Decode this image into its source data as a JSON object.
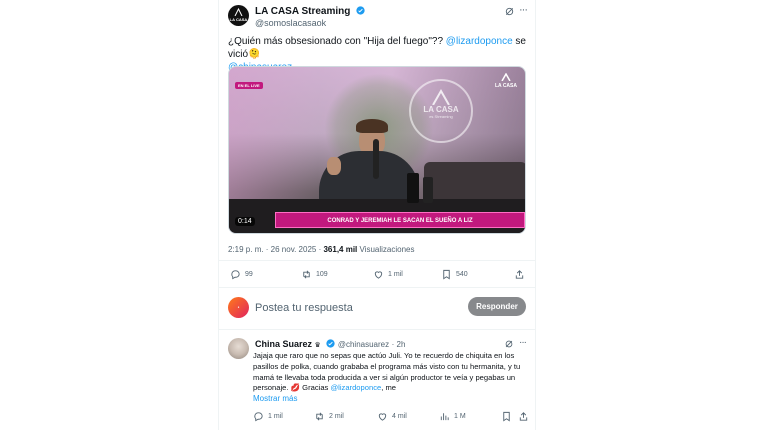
{
  "post": {
    "author_name": "LA CASA Streaming",
    "author_handle": "@somoslacasaok",
    "avatar_text": "LA CASA",
    "text_before": "¿Quién más obsesionado con \"Hija del fuego\"?? ",
    "mention1": "@lizardoponce",
    "text_after": " se vició",
    "emoji": "🫠",
    "mention2": "@chinasuarez",
    "video": {
      "live_badge": "EN EL LIVE",
      "logo_big": "LA CASA",
      "logo_sub": "es Streaming",
      "logo_corner": "LA CASA",
      "duration": "0:14",
      "caption": "CONRAD Y JEREMIAH LE SACAN EL SUEÑO A LIZ"
    },
    "timestamp": "2:19 p. m. · 26 nov. 2025 · ",
    "views_value": "361,4 mil",
    "views_label": " Visualizaciones",
    "stats": {
      "replies": "99",
      "reposts": "109",
      "likes": "1 mil",
      "bookmarks": "540"
    }
  },
  "composer": {
    "placeholder": "Postea tu respuesta",
    "reply_button": "Responder"
  },
  "reply": {
    "author_name": "China Suarez",
    "author_handle": "@chinasuarez",
    "time": "· 2h",
    "text": "Jajaja que raro que no sepas que actúo Juli. Yo te recuerdo de chiquita en los pasillos de polka, cuando grababa el programa más visto con tu hermanita, y tu mamá te llevaba toda producida a ver si algún productor te veía y pegabas un personaje.",
    "kiss_emoji": "💋",
    "text_tail": " Gracias ",
    "mention": "@lizardoponce",
    "text_end": ", me",
    "show_more": "Mostrar más",
    "stats": {
      "replies": "1 mil",
      "reposts": "2 mil",
      "likes": "4 mil",
      "views": "1 M"
    }
  },
  "colors": {
    "accent": "#1d9bf0",
    "caption_bg": "#c2197e",
    "button": "#87898c"
  }
}
